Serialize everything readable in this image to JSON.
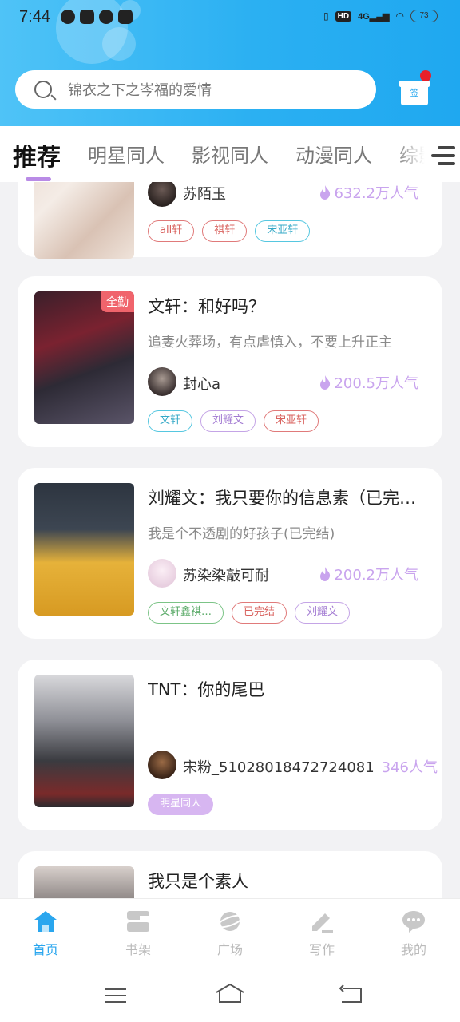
{
  "status_bar": {
    "time": "7:44",
    "network": "4G",
    "hd": "HD",
    "battery": "73"
  },
  "search": {
    "placeholder": "锦衣之下之岑福的爱情"
  },
  "checkin": {
    "label": "签"
  },
  "tabs": [
    {
      "label": "推荐",
      "active": true
    },
    {
      "label": "明星同人",
      "active": false
    },
    {
      "label": "影视同人",
      "active": false
    },
    {
      "label": "动漫同人",
      "active": false
    },
    {
      "label": "综影",
      "active": false
    }
  ],
  "cards": [
    {
      "title": "",
      "author": "苏陌玉",
      "popularity": "632.2万人气",
      "tags": [
        {
          "label": "all轩",
          "style": "red"
        },
        {
          "label": "祺轩",
          "style": "red"
        },
        {
          "label": "宋亚轩",
          "style": "teal"
        }
      ]
    },
    {
      "title": "文轩：和好吗？",
      "badge": "全勤",
      "description": "追妻火葬场，有点虐慎入，不要上升正主",
      "author": "封心a",
      "popularity": "200.5万人气",
      "tags": [
        {
          "label": "文轩",
          "style": "teal"
        },
        {
          "label": "刘耀文",
          "style": "purple"
        },
        {
          "label": "宋亚轩",
          "style": "red"
        }
      ]
    },
    {
      "title": "刘耀文：我只要你的信息素（已完结）",
      "description": "我是个不透剧的好孩子(已完结)",
      "author": "苏染染敲可耐",
      "popularity": "200.2万人气",
      "tags": [
        {
          "label": "文轩鑫祺…",
          "style": "green"
        },
        {
          "label": "已完结",
          "style": "red"
        },
        {
          "label": "刘耀文",
          "style": "purple"
        }
      ]
    },
    {
      "title": "TNT：你的尾巴",
      "description": "",
      "author": "宋粉_51028018472724081",
      "popularity": "346人气",
      "tags": [
        {
          "label": "明星同人",
          "style": "solid-purple"
        }
      ]
    },
    {
      "title": "我只是个素人"
    }
  ],
  "bottom_nav": [
    {
      "label": "首页",
      "icon": "home-icon",
      "active": true
    },
    {
      "label": "书架",
      "icon": "bookshelf-icon",
      "active": false
    },
    {
      "label": "广场",
      "icon": "planet-icon",
      "active": false
    },
    {
      "label": "写作",
      "icon": "pen-icon",
      "active": false
    },
    {
      "label": "我的",
      "icon": "chat-bubble-icon",
      "active": false
    }
  ],
  "colors": {
    "header_blue": "#2bb0f2",
    "accent_purple": "#b98be6",
    "popularity_purple": "#c9a4ee",
    "active_nav": "#2aa6ee"
  }
}
